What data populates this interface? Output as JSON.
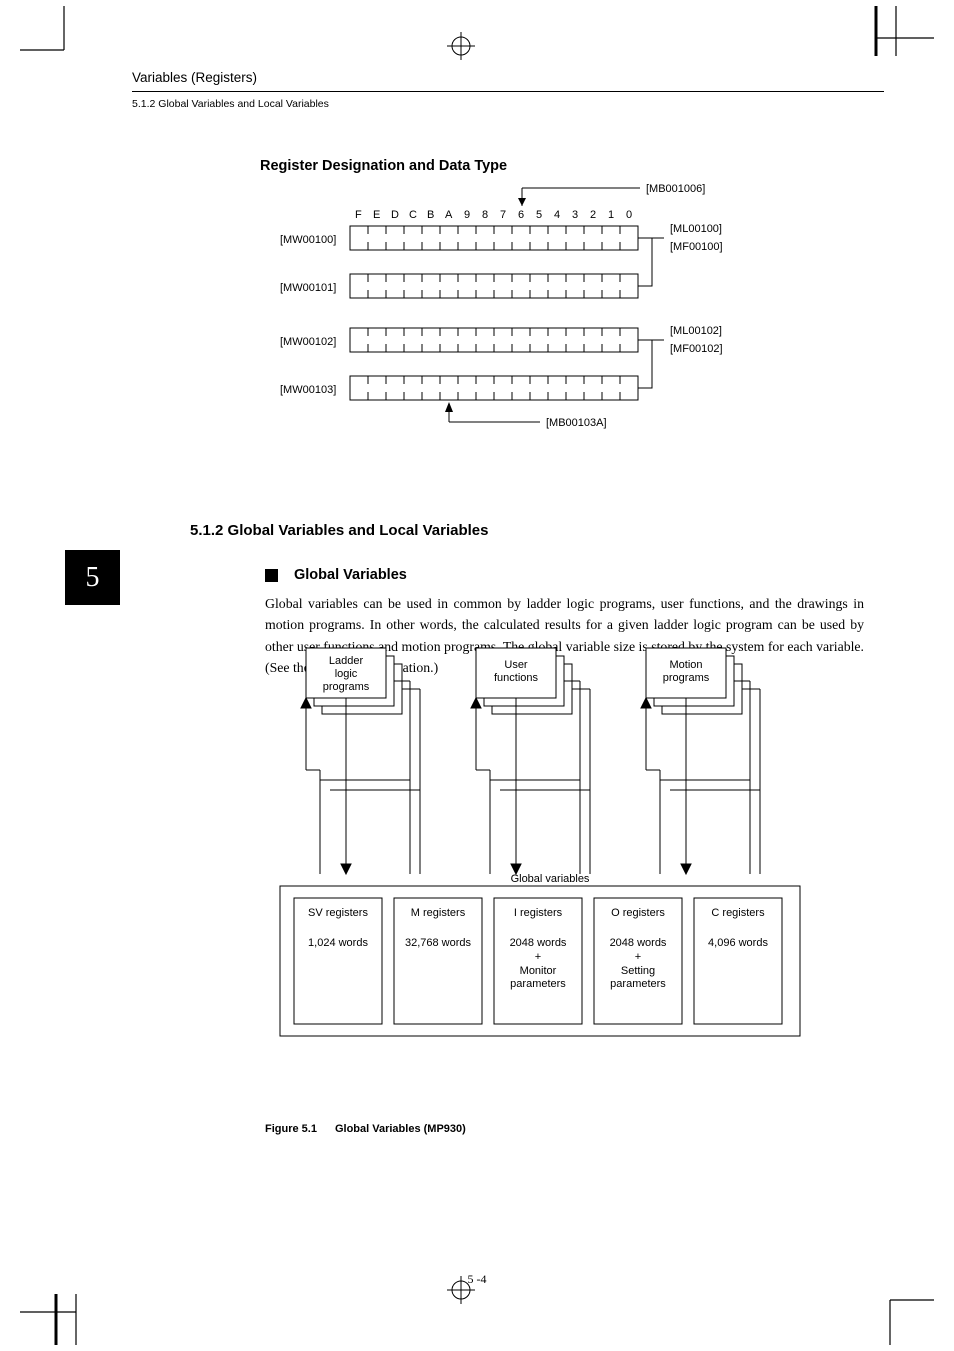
{
  "header": {
    "title": "Variables (Registers)",
    "subsection": "5.1.2  Global Variables and Local Variables"
  },
  "chapter_tab": "5",
  "section_title": "Register Designation and Data Type",
  "register_diagram": {
    "bit_labels": [
      "F",
      "E",
      "D",
      "C",
      "B",
      "A",
      "9",
      "8",
      "7",
      "6",
      "5",
      "4",
      "3",
      "2",
      "1",
      "0"
    ],
    "top_pointer": "[MB001006]",
    "word_labels": [
      "[MW00100]",
      "[MW00101]",
      "[MW00102]",
      "[MW00103]"
    ],
    "right_pair_0": [
      "[ML00100]",
      "[MF00100]"
    ],
    "right_pair_1": [
      "[ML00102]",
      "[MF00102]"
    ],
    "bottom_pointer": "[MB00103A]"
  },
  "h2": "5.1.2  Global Variables and Local Variables",
  "h3": "Global Variables",
  "paragraph": "Global variables can be used in common by ladder logic programs, user functions, and the drawings in motion programs. In other words, the calculated results for a given ladder logic program can be used by other user functions and motion programs. The global variable size is stored by the system for each variable. (See the following illustration.)",
  "gv_diagram": {
    "top_boxes": [
      {
        "l1": "Ladder",
        "l2": "logic",
        "l3": "programs"
      },
      {
        "l1": "User",
        "l2": "functions",
        "l3": ""
      },
      {
        "l1": "Motion",
        "l2": "programs",
        "l3": ""
      }
    ],
    "bottom_title": "Global variables",
    "regs": [
      {
        "name": "SV registers",
        "cap": "1,024 words",
        "extra1": "",
        "extra2": ""
      },
      {
        "name": "M registers",
        "cap": "32,768 words",
        "extra1": "",
        "extra2": ""
      },
      {
        "name": "I registers",
        "cap": "2048 words",
        "extra1": "+",
        "extra2": "Monitor parameters"
      },
      {
        "name": "O registers",
        "cap": "2048 words",
        "extra1": "+",
        "extra2": "Setting parameters"
      },
      {
        "name": "C registers",
        "cap": "4,096 words",
        "extra1": "",
        "extra2": ""
      }
    ]
  },
  "figure_caption": {
    "num": "Figure 5.1",
    "text": "Global Variables (MP930)"
  },
  "page_number": "5 -4"
}
